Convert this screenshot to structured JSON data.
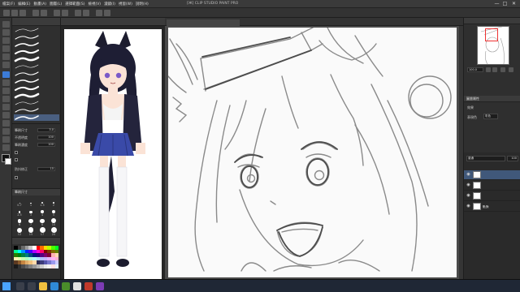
{
  "window": {
    "title": "[Ж] CLIP STUDIO PAINT PRO",
    "menu": [
      "檔案(F)",
      "編輯(E)",
      "動畫(A)",
      "圖層(L)",
      "選擇範圍(S)",
      "檢視(V)",
      "濾鏡(I)",
      "視窗(W)",
      "說明(H)"
    ],
    "controls": {
      "minimize": "—",
      "maximize": "□",
      "close": "✕"
    }
  },
  "subtool_panel": {
    "brushes": [
      "",
      "",
      "",
      "",
      "",
      "",
      "",
      "",
      "",
      "",
      "",
      "",
      ""
    ],
    "selected_index": 12
  },
  "tool_property": {
    "rows": [
      {
        "label": "筆刷尺寸",
        "value": "3.0"
      },
      {
        "label": "不透明度",
        "value": "100"
      },
      {
        "label": "筆刷濃度",
        "value": "100"
      },
      {
        "label": "",
        "value": ""
      },
      {
        "label": "",
        "value": ""
      },
      {
        "label": "防抖修正",
        "value": "15"
      },
      {
        "label": "",
        "value": ""
      }
    ]
  },
  "brush_size": {
    "title": "筆刷尺寸",
    "sizes": [
      "0.7",
      "1",
      "1.5",
      "2",
      "2.5",
      "3",
      "4",
      "5",
      "6",
      "7",
      "8",
      "10",
      "12",
      "15",
      "17",
      "20"
    ]
  },
  "color_set": {
    "title": "",
    "colors": [
      "#000000",
      "#3a3a3a",
      "#6a6a6a",
      "#9a9a9a",
      "#c8c8c8",
      "#ffffff",
      "#ff0000",
      "#ff6a00",
      "#ffd800",
      "#b6ff00",
      "#4cff00",
      "#00ff21",
      "#00ff90",
      "#00ffff",
      "#0094ff",
      "#0026ff",
      "#4800ff",
      "#b200ff",
      "#ff00dc",
      "#ff006e",
      "#7f0000",
      "#7f3300",
      "#7f6a00",
      "#5b7f00",
      "#267f00",
      "#007f0e",
      "#007f46",
      "#007f7f",
      "#004a7f",
      "#00137f",
      "#21007f",
      "#57007f",
      "#7f006e",
      "#7f0037",
      "#ffb2b2",
      "#ffd8b2",
      "#fff4b2",
      "#e5ffb2",
      "#c8ffb2",
      "#b2ffc0",
      "#b2ffe1",
      "#b2ffff",
      "#b2e1ff",
      "#b2c0ff",
      "#c8b2ff",
      "#e5b2ff",
      "#ffb2f4",
      "#ffb2d2",
      "#5c3a21",
      "#8b5a2b",
      "#c68642",
      "#e0ac69",
      "#f1c27d",
      "#ffdbac",
      "#2d2d52",
      "#3b3b7a",
      "#5555aa",
      "#7777cc",
      "#9999ee",
      "#ccccff",
      "#1a1a1a",
      "#333333",
      "#4d4d4d",
      "#666666",
      "#808080",
      "#999999",
      "#b3b3b3",
      "#cccccc",
      "#e6e6e6",
      "#f2f2f2",
      "#ffe0e0",
      "#e0f0ff"
    ],
    "main_color": "#111111",
    "sub_color": "#ffffff"
  },
  "canvas": {
    "tab_label": "",
    "accent": "#3c7bd6"
  },
  "navigator": {
    "title": "",
    "zoom": "100.0"
  },
  "layer_property": {
    "title": "圖層屬性",
    "effect_label": "效果",
    "expression_label": "表現色",
    "expression_value": "彩色"
  },
  "layers": {
    "blend_mode": "普通",
    "opacity": "100",
    "items": [
      {
        "name": "",
        "visible": true,
        "selected": true
      },
      {
        "name": "",
        "visible": true,
        "selected": false
      },
      {
        "name": "",
        "visible": true,
        "selected": false
      },
      {
        "name": "紙張",
        "visible": true,
        "selected": false
      }
    ]
  },
  "taskbar": {
    "time": "",
    "date": ""
  }
}
